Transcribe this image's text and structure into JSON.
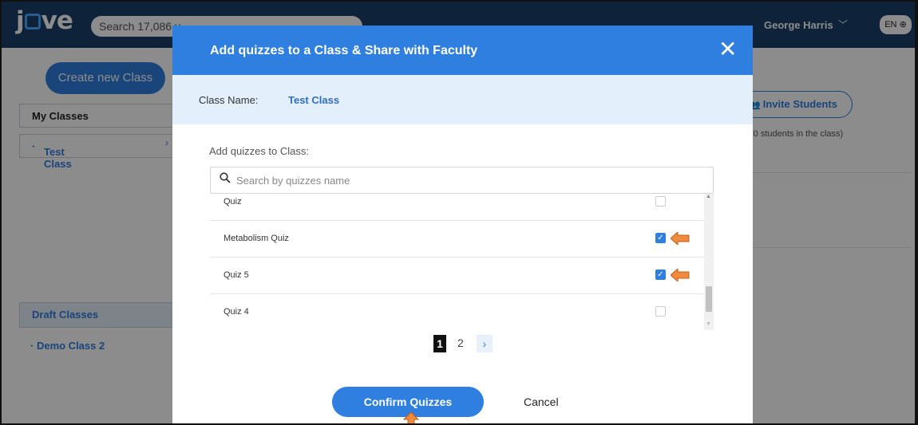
{
  "header": {
    "logo_text": "jove",
    "search_placeholder": "Search 17,086 v",
    "user_name": "George Harris",
    "language": "EN"
  },
  "sidebar": {
    "create_button": "Create new Class",
    "my_classes": "My Classes",
    "active_class": "Test Class",
    "draft_classes": "Draft Classes",
    "draft_items": [
      "Demo Class 2"
    ]
  },
  "main": {
    "invite_button": "Invite Students",
    "students_count": "(0 students in the class)"
  },
  "modal": {
    "title": "Add quizzes to a Class & Share with Faculty",
    "class_label": "Class Name:",
    "class_name": "Test Class",
    "add_label": "Add quizzes to Class:",
    "search_placeholder": "Search by quizzes name",
    "quizzes": [
      {
        "name": "Quiz",
        "checked": false
      },
      {
        "name": "Metabolism Quiz",
        "checked": true
      },
      {
        "name": "Quiz 5",
        "checked": true
      },
      {
        "name": "Quiz 4",
        "checked": false
      }
    ],
    "pagination": {
      "current": "1",
      "next_page": "2",
      "next_icon": "›"
    },
    "confirm_button": "Confirm Quizzes",
    "cancel_button": "Cancel"
  },
  "colors": {
    "accent": "#2f7fe0",
    "header_bg": "#1a3f6b",
    "annotation_arrow": "#f08a3c"
  }
}
